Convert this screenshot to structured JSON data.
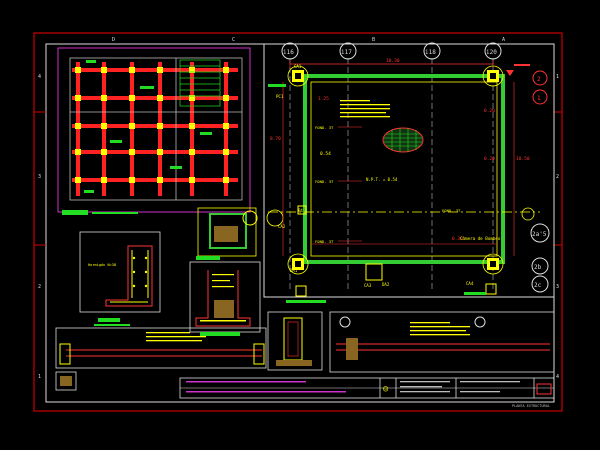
{
  "colors": {
    "background": "#000000",
    "sheet_border": "#cc0000",
    "frame": "#e8e8e8",
    "plan_wall": "#33cc33",
    "beam": "#ff2222",
    "column": "#ffff00",
    "dimension": "#ff3333",
    "axis": "#cccccc",
    "magenta": "#cc33cc",
    "hatch": "#22dd22",
    "text_yellow": "#ffff00"
  },
  "ruler": {
    "top": [
      "D",
      "C",
      "B",
      "A"
    ],
    "right": [
      "1",
      "2",
      "3",
      "4"
    ],
    "left": [
      "4",
      "3",
      "2",
      "1"
    ]
  },
  "grid_axes": [
    "i16",
    "i17",
    "i18",
    "i20"
  ],
  "right_bubbles": [
    "2",
    "1",
    "2a'5",
    "2b",
    "2c"
  ],
  "plan_labels": {
    "camera": "Câmera de Bombeo",
    "npt": "N.P.T. = 0.54",
    "pc1": "PC1",
    "dims": [
      "0.20",
      "0.20",
      "10.30",
      "8.70",
      "0.30",
      "10.50",
      "4.90",
      "9.20",
      "1.25",
      "0.30",
      "0.54"
    ],
    "tags": [
      "CA1",
      "CA2",
      "CA3",
      "CA4",
      "DA1",
      "DA2",
      "P4"
    ],
    "fnd": [
      "FOND. 3T",
      "FOND. 3T",
      "FOND. 3T",
      "FOND. 3T",
      "FOND. 3T"
    ]
  },
  "detail_labels": {
    "hormigon": "Hormigón N=38"
  },
  "title_block": {
    "logo": "☺",
    "caption": "PLANTA ESTRUCTURAL"
  }
}
